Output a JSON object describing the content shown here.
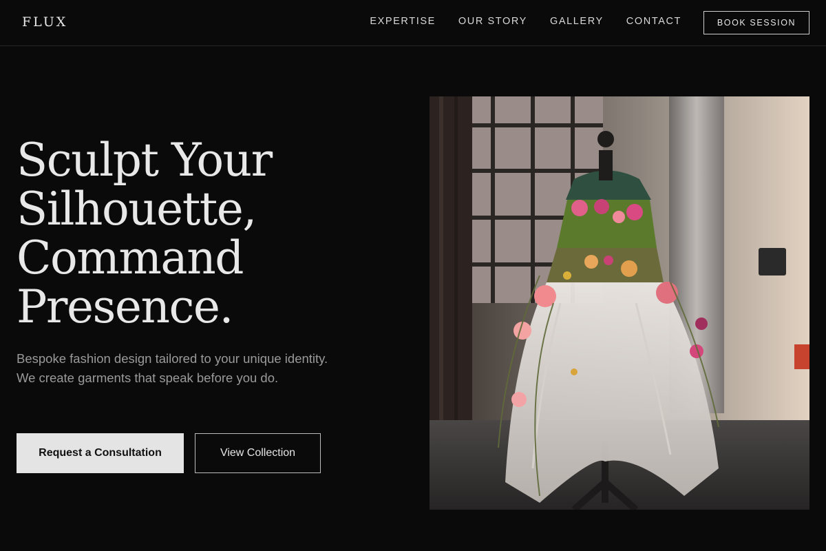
{
  "brand": {
    "logo": "FLUX"
  },
  "nav": {
    "items": [
      {
        "label": "EXPERTISE"
      },
      {
        "label": "OUR STORY"
      },
      {
        "label": "GALLERY"
      },
      {
        "label": "CONTACT"
      }
    ],
    "cta_label": "BOOK SESSION"
  },
  "hero": {
    "headline_lines": [
      "Sculpt Your",
      "Silhouette,",
      "Command",
      "Presence."
    ],
    "subtext": "Bespoke fashion design tailored to your unique identity. We create garments that speak before you do.",
    "primary_label": "Request a Consultation",
    "secondary_label": "View Collection"
  },
  "colors": {
    "background": "#0a0a0a",
    "text": "#e8e8e8",
    "muted": "#9a9a9a",
    "primary_button": "#e4e4e4"
  }
}
